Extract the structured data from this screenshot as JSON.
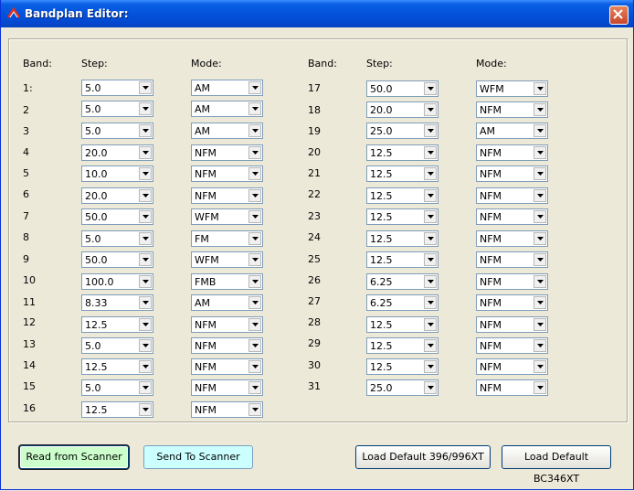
{
  "window": {
    "title": "Bandplan Editor:"
  },
  "headers": {
    "band": "Band:",
    "step": "Step:",
    "mode": "Mode:"
  },
  "bands": [
    {
      "band": "1:",
      "step": "5.0",
      "mode": "AM"
    },
    {
      "band": "2",
      "step": "5.0",
      "mode": "AM"
    },
    {
      "band": "3",
      "step": "5.0",
      "mode": "AM"
    },
    {
      "band": "4",
      "step": "20.0",
      "mode": "NFM"
    },
    {
      "band": "5",
      "step": "10.0",
      "mode": "NFM"
    },
    {
      "band": "6",
      "step": "20.0",
      "mode": "NFM"
    },
    {
      "band": "7",
      "step": "50.0",
      "mode": "WFM"
    },
    {
      "band": "8",
      "step": "5.0",
      "mode": "FM"
    },
    {
      "band": "9",
      "step": "50.0",
      "mode": "WFM"
    },
    {
      "band": "10",
      "step": "100.0",
      "mode": "FMB"
    },
    {
      "band": "11",
      "step": "8.33",
      "mode": "AM"
    },
    {
      "band": "12",
      "step": "12.5",
      "mode": "NFM"
    },
    {
      "band": "13",
      "step": "5.0",
      "mode": "NFM"
    },
    {
      "band": "14",
      "step": "12.5",
      "mode": "NFM"
    },
    {
      "band": "15",
      "step": "5.0",
      "mode": "NFM"
    },
    {
      "band": "16",
      "step": "12.5",
      "mode": "NFM"
    },
    {
      "band": "17",
      "step": "50.0",
      "mode": "WFM"
    },
    {
      "band": "18",
      "step": "20.0",
      "mode": "NFM"
    },
    {
      "band": "19",
      "step": "25.0",
      "mode": "AM"
    },
    {
      "band": "20",
      "step": "12.5",
      "mode": "NFM"
    },
    {
      "band": "21",
      "step": "12.5",
      "mode": "NFM"
    },
    {
      "band": "22",
      "step": "12.5",
      "mode": "NFM"
    },
    {
      "band": "23",
      "step": "12.5",
      "mode": "NFM"
    },
    {
      "band": "24",
      "step": "12.5",
      "mode": "NFM"
    },
    {
      "band": "25",
      "step": "12.5",
      "mode": "NFM"
    },
    {
      "band": "26",
      "step": "6.25",
      "mode": "NFM"
    },
    {
      "band": "27",
      "step": "6.25",
      "mode": "NFM"
    },
    {
      "band": "28",
      "step": "12.5",
      "mode": "NFM"
    },
    {
      "band": "29",
      "step": "12.5",
      "mode": "NFM"
    },
    {
      "band": "30",
      "step": "12.5",
      "mode": "NFM"
    },
    {
      "band": "31",
      "step": "25.0",
      "mode": "NFM"
    }
  ],
  "buttons": {
    "read": "Read from Scanner",
    "send": "Send To Scanner",
    "load396": "Load Default 396/996XT",
    "load346": "Load Default BC346XT"
  },
  "colors": {
    "read_bg": "#CCFFCC",
    "send_bg": "#CCFFFF",
    "title_bar": "#0453DB"
  }
}
